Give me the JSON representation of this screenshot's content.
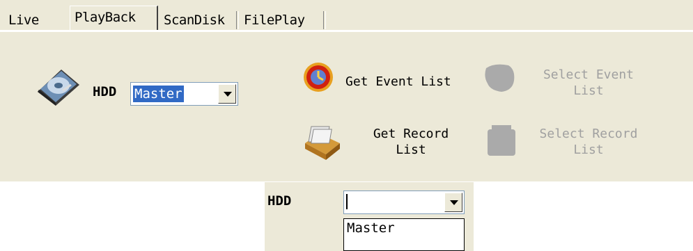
{
  "tabs": [
    {
      "label": "Live"
    },
    {
      "label": "PlayBack"
    },
    {
      "label": "ScanDisk"
    },
    {
      "label": "FilePlay"
    }
  ],
  "hdd": {
    "label": "HDD",
    "value": "Master"
  },
  "buttons": {
    "get_event": "Get Event List",
    "select_event_1": "Select Event",
    "select_event_2": "List",
    "get_record_1": "Get Record",
    "get_record_2": "List",
    "select_record_1": "Select Record",
    "select_record_2": "List"
  },
  "detail": {
    "label": "HDD",
    "value": "",
    "option": "Master"
  }
}
